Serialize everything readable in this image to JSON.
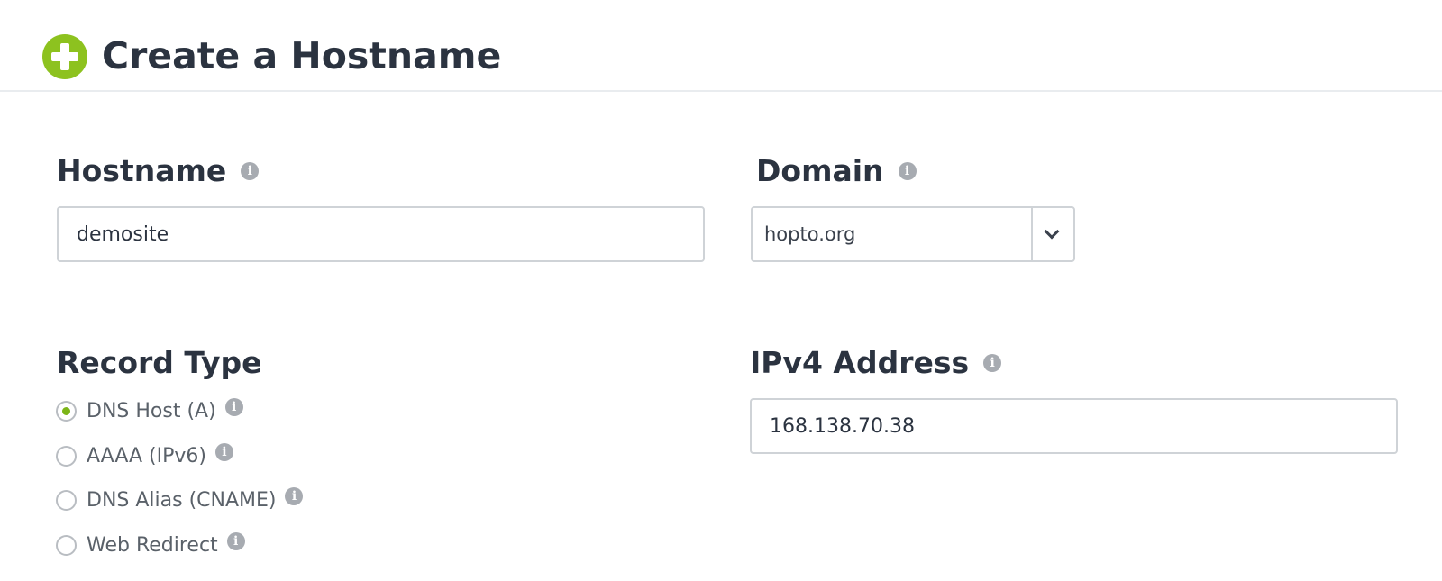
{
  "header": {
    "title": "Create a Hostname",
    "icon": "plus-circle-icon",
    "accent_color": "#8dc21f"
  },
  "hostname": {
    "label": "Hostname",
    "value": "demosite"
  },
  "domain": {
    "label": "Domain",
    "selected": "hopto.org"
  },
  "record_type": {
    "label": "Record Type",
    "options": [
      {
        "label": "DNS Host (A)",
        "checked": true
      },
      {
        "label": "AAAA (IPv6)",
        "checked": false
      },
      {
        "label": "DNS Alias (CNAME)",
        "checked": false
      },
      {
        "label": "Web Redirect",
        "checked": false
      }
    ]
  },
  "ipv4": {
    "label": "IPv4 Address",
    "value": "168.138.70.38"
  }
}
